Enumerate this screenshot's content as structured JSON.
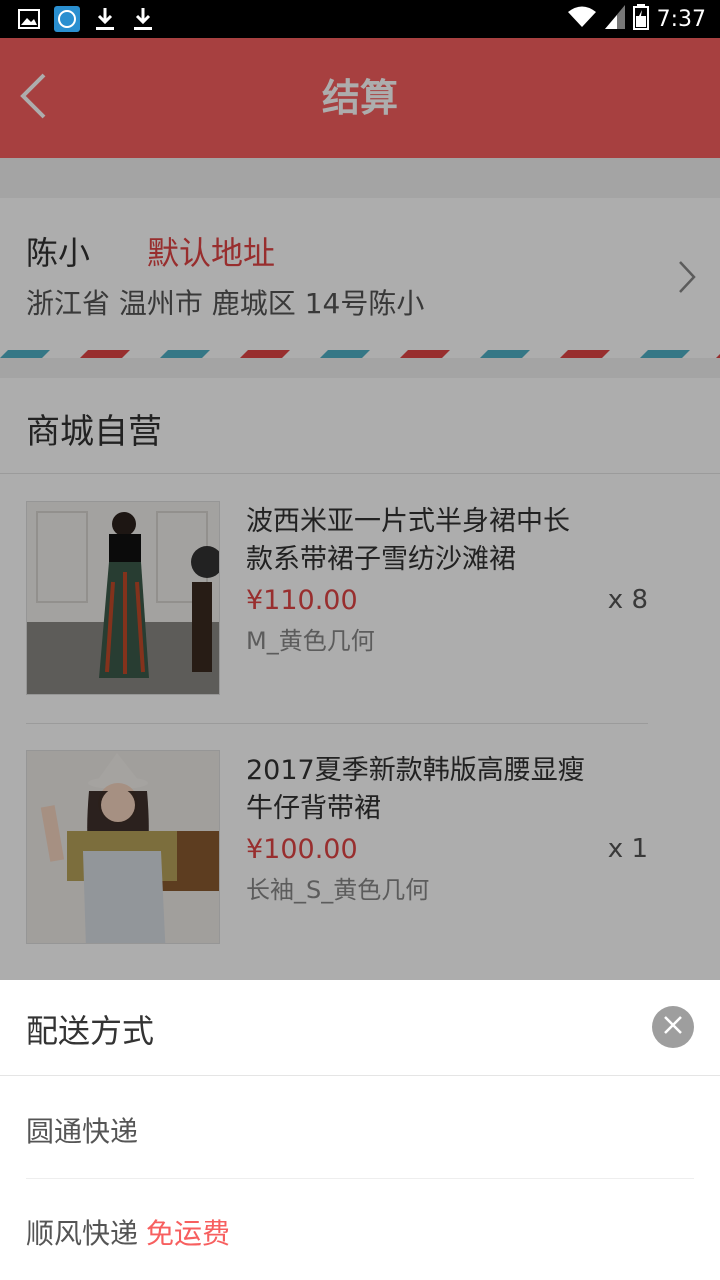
{
  "status_bar": {
    "time": "7:37",
    "left_icons": [
      "image-icon",
      "app-icon",
      "download-icon",
      "download-icon"
    ],
    "right_icons": [
      "wifi-icon",
      "signal-icon",
      "battery-icon"
    ]
  },
  "header": {
    "title": "结算",
    "back_icon": "chevron-left-icon",
    "color": "#f75f5f"
  },
  "address": {
    "name": "陈小",
    "default_label": "默认地址",
    "detail": "浙江省 温州市 鹿城区 14号陈小",
    "arrow_icon": "chevron-right-icon"
  },
  "store": {
    "title": "商城自营",
    "items": [
      {
        "name": "波西米亚一片式半身裙中长款系带裙子雪纺沙滩裙",
        "price": "¥110.00",
        "spec": "M_黄色几何",
        "qty": "x 8"
      },
      {
        "name": "2017夏季新款韩版高腰显瘦牛仔背带裙",
        "price": "¥100.00",
        "spec": "长袖_S_黄色几何",
        "qty": "x 1"
      }
    ]
  },
  "shipping_sheet": {
    "title": "配送方式",
    "close_icon": "close-icon",
    "options": [
      {
        "label": "圆通快递",
        "badge": ""
      },
      {
        "label": "顺风快递",
        "badge": "免运费"
      }
    ]
  },
  "colors": {
    "accent": "#f75f5f",
    "price": "#e04545"
  }
}
